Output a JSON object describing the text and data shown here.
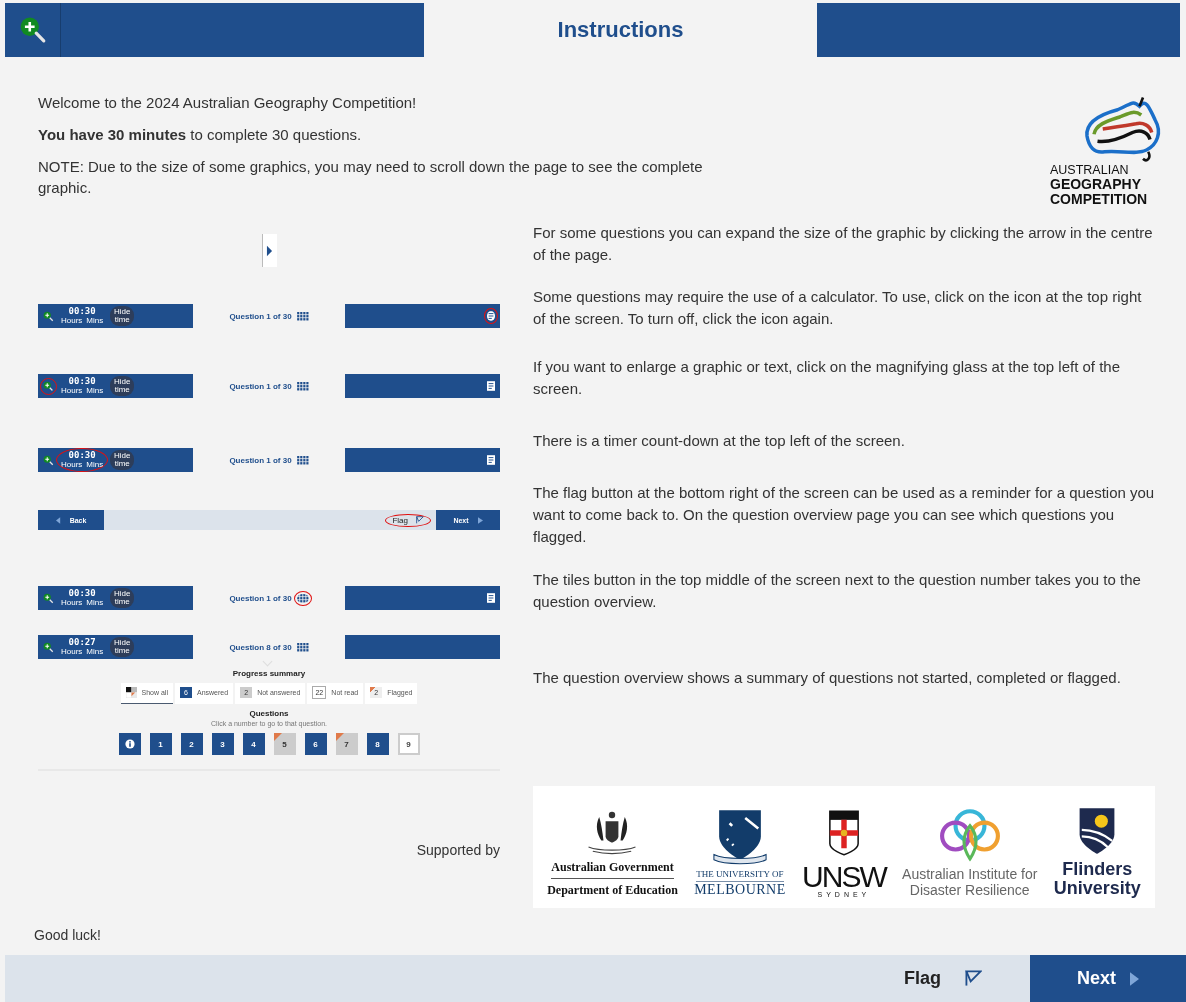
{
  "header": {
    "title": "Instructions"
  },
  "intro": [
    "Welcome to the 2024 Australian Geography Competition!",
    "**You have 30 minutes** to complete 30 questions.",
    "NOTE: Due to the size of some graphics, you may need to scroll down the page to see the complete graphic."
  ],
  "logo": {
    "lines": [
      "AUSTRALIAN",
      "GEOGRAPHY",
      "COMPETITION"
    ]
  },
  "steps": [
    {
      "kind": "expand",
      "text": "For some questions you can expand the size of the graphic by clicking the arrow in the centre of the page."
    },
    {
      "kind": "toolbar",
      "toolbar": {
        "time": "00:30",
        "hours_label": "Hours",
        "mins_label": "Mins",
        "hide_label": "Hide time",
        "question": "Question 1 of 30",
        "calculator": true,
        "zoom_circled": false,
        "timer_circled": false,
        "tiles_circled": false,
        "calculator_circled": true
      },
      "text": "Some questions may require the use of a calculator. To use, click on the icon at the top right of the screen. To turn off, click the icon again."
    },
    {
      "kind": "toolbar",
      "toolbar": {
        "time": "00:30",
        "hours_label": "Hours",
        "mins_label": "Mins",
        "hide_label": "Hide time",
        "question": "Question 1 of 30",
        "calculator": true,
        "zoom_circled": true,
        "timer_circled": false,
        "tiles_circled": false,
        "calculator_circled": false
      },
      "text": "If you want to enlarge a graphic or text, click on the magnifying glass at the top left of the screen."
    },
    {
      "kind": "toolbar",
      "toolbar": {
        "time": "00:30",
        "hours_label": "Hours",
        "mins_label": "Mins",
        "hide_label": "Hide time",
        "question": "Question 1 of 30",
        "calculator": true,
        "zoom_circled": false,
        "timer_circled": true,
        "tiles_circled": false,
        "calculator_circled": false
      },
      "text": "There is a timer count-down at the top left of the screen."
    },
    {
      "kind": "nav",
      "nav": {
        "back": "Back",
        "flag": "Flag",
        "next": "Next",
        "flag_circled": true
      },
      "text": "The flag button at the bottom right of the screen can be used as a reminder for a question you want to come back to. On the question overview page you can see which questions you flagged."
    },
    {
      "kind": "toolbar",
      "toolbar": {
        "time": "00:30",
        "hours_label": "Hours",
        "mins_label": "Mins",
        "hide_label": "Hide time",
        "question": "Question 1 of 30",
        "calculator": true,
        "zoom_circled": false,
        "timer_circled": false,
        "tiles_circled": true,
        "calculator_circled": false
      },
      "text": "The tiles button in the top middle of the screen next to the question number takes you to the question overview."
    },
    {
      "kind": "overview",
      "toolbar": {
        "time": "00:27",
        "hours_label": "Hours",
        "mins_label": "Mins",
        "hide_label": "Hide time",
        "question": "Question 8 of 30",
        "calculator": false,
        "zoom_circled": false,
        "timer_circled": false,
        "tiles_circled": false
      },
      "summary": {
        "title": "Progress summary",
        "filters": [
          {
            "kind": "all",
            "label": "Show all",
            "selected": true
          },
          {
            "kind": "answered",
            "count": "6",
            "label": "Answered",
            "selected": false
          },
          {
            "kind": "not_answered",
            "count": "2",
            "label": "Not answered",
            "selected": false
          },
          {
            "kind": "not_read",
            "count": "22",
            "label": "Not read",
            "selected": false
          },
          {
            "kind": "flagged",
            "count": "2",
            "label": "Flagged",
            "selected": false
          }
        ],
        "questions_title": "Questions",
        "hint": "Click a number to go to that question.",
        "tiles": [
          {
            "kind": "info"
          },
          {
            "kind": "answered",
            "label": "1"
          },
          {
            "kind": "answered",
            "label": "2"
          },
          {
            "kind": "answered",
            "label": "3"
          },
          {
            "kind": "answered",
            "label": "4"
          },
          {
            "kind": "flagged",
            "label": "5"
          },
          {
            "kind": "answered",
            "label": "6"
          },
          {
            "kind": "flagged",
            "label": "7"
          },
          {
            "kind": "answered",
            "label": "8"
          },
          {
            "kind": "not_read",
            "label": "9"
          }
        ]
      },
      "text": "The question overview shows a summary of questions not started, completed or flagged."
    }
  ],
  "sponsors": {
    "label": "Supported by",
    "logos": [
      {
        "kind": "gov",
        "lines": [
          "Australian Government",
          "Department of Education"
        ]
      },
      {
        "kind": "melbourne",
        "lines": [
          "THE UNIVERSITY OF",
          "MELBOURNE"
        ]
      },
      {
        "kind": "unsw",
        "lines": [
          "UNSW",
          "SYDNEY"
        ]
      },
      {
        "kind": "aidr",
        "lines": [
          "Australian Institute for",
          "Disaster Resilience"
        ]
      },
      {
        "kind": "flinders",
        "lines": [
          "Flinders",
          "University"
        ]
      }
    ]
  },
  "closing": "Good luck!",
  "footer": {
    "flag": "Flag",
    "next": "Next"
  }
}
